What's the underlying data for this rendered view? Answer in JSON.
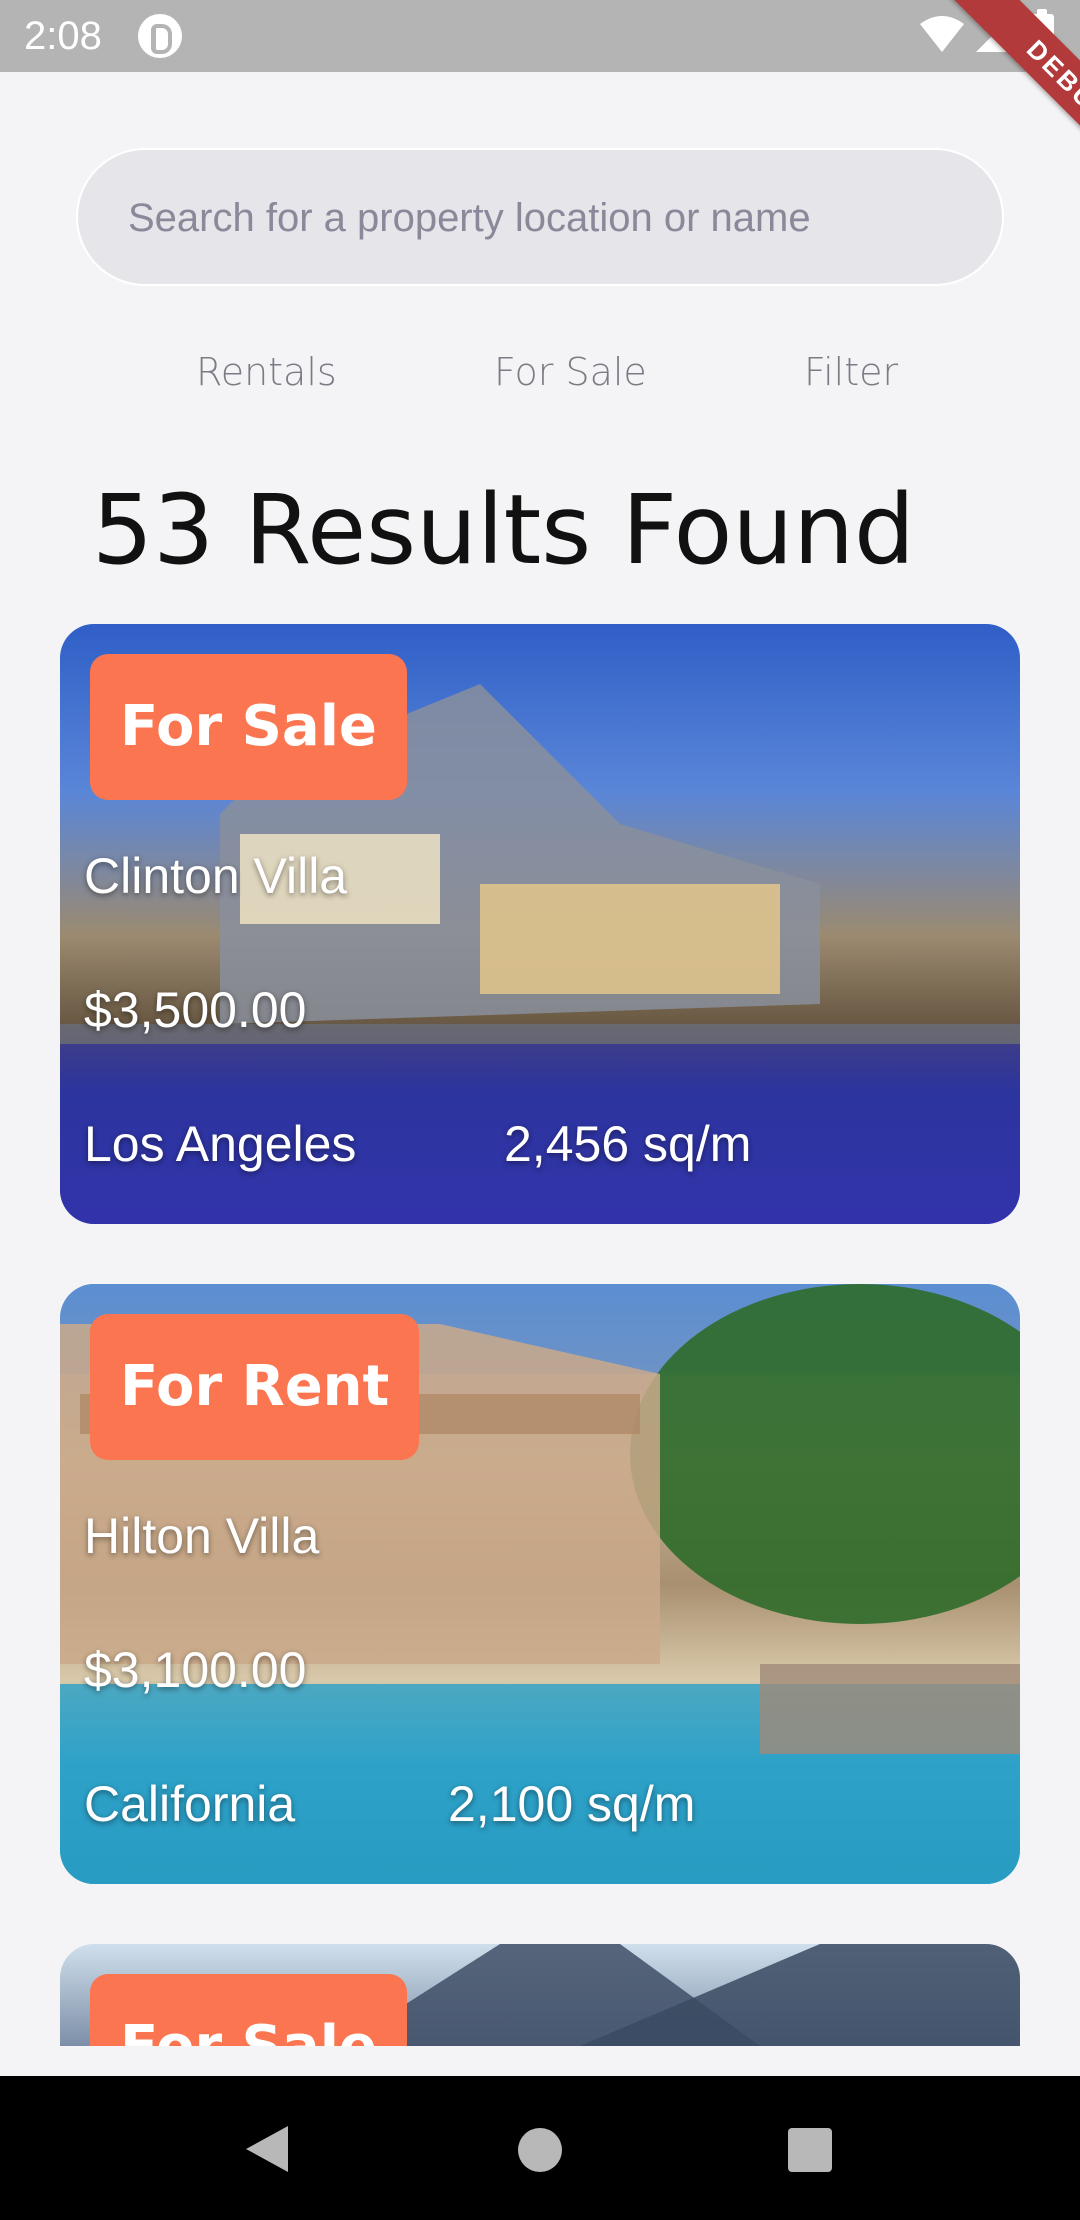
{
  "status_bar": {
    "time": "2:08",
    "debug_label": "DEBUG",
    "icons": [
      "app-notification-icon",
      "wifi-icon",
      "signal-icon",
      "battery-icon"
    ]
  },
  "search": {
    "placeholder": "Search for a property location or name",
    "value": ""
  },
  "tabs": [
    {
      "label": "Rentals"
    },
    {
      "label": "For Sale"
    },
    {
      "label": "Filter"
    }
  ],
  "results_title": "53 Results Found",
  "listings": [
    {
      "badge": "For Sale",
      "name": "Clinton Villa",
      "price": "$3,500.00",
      "location": "Los Angeles",
      "area": "2,456 sq/m"
    },
    {
      "badge": "For Rent",
      "name": "Hilton Villa",
      "price": "$3,100.00",
      "location": "California",
      "area": "2,100 sq/m"
    },
    {
      "badge": "For Sale"
    }
  ],
  "colors": {
    "badge": "#fb7550",
    "background": "#f4f4f6",
    "status_bar": "#b4b4b4",
    "debug_ribbon": "#b33a3a"
  },
  "nav_bar": {
    "icons": [
      "back-icon",
      "home-icon",
      "recents-icon"
    ]
  }
}
